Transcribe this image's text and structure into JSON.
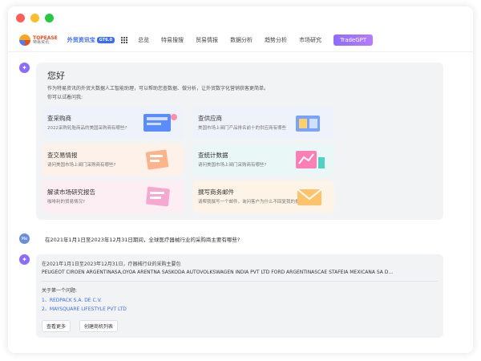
{
  "nav": {
    "logo_line1": "TOPEASE",
    "logo_line2": "特易资讯",
    "brand": "外贸资讯宝",
    "brand_badge": "GT6.0",
    "items": [
      "总览",
      "特易搜搜",
      "贸易情报",
      "数据分析",
      "趋势分析",
      "市场研究"
    ],
    "gpt_label": "TradeGPT"
  },
  "greeting": {
    "title": "您好",
    "description": "作为特易资讯的外贸大数据人工智能助理，可以帮助您查数据、做分析，让外贸数字化营销获客更简单。",
    "hint": "你可以试着问我:"
  },
  "cards": [
    {
      "title": "查采购商",
      "subtitle": "2022采购轮胎商品的美国采购商有哪些?"
    },
    {
      "title": "查供应商",
      "subtitle": "美国市场上阀门产品排名前十的供应商有哪些"
    },
    {
      "title": "查交易情报",
      "subtitle": "请问美国市场上阀门采购商有哪些?"
    },
    {
      "title": "查统计数据",
      "subtitle": "请问美国市场上阀门采购商有哪些?"
    },
    {
      "title": "解读市场研究报告",
      "subtitle": "咖啡利的贸易情况?"
    },
    {
      "title": "撰写商务邮件",
      "subtitle": "请帮我撰写一个邮件，询问客户为什么不回复我的报价"
    }
  ],
  "user_avatar": "Me",
  "question": "在2021年1月1日至2023年12月31日期间，全球医疗器械行业的采购商主要有哪些?",
  "answer": {
    "heading": "在2021年1月1日至2023年12月31日，疗器械行业的采购主要包",
    "names": "PEUGEOT CIROEN ARGENTINASA,OYOA ARENTNA SASKODA AUTOVOLKSWAGEN INDIA PVT LTD FORD ARGENTINASCAE STAFEIA MEXICANA SA D...",
    "related_title": "关于第一个问题:",
    "links": [
      "1、REDPACK S.A. DE C.V.",
      "2、MAYSQUARE LIFESTYLE PVT LTD"
    ],
    "btn_more": "查看更多",
    "btn_create": "创建商机列表"
  }
}
